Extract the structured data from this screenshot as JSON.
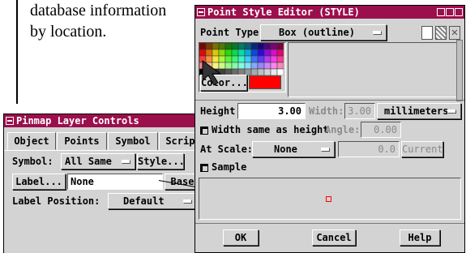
{
  "doc": {
    "text": "database information by location."
  },
  "pinmap": {
    "title": "Pinmap Layer Controls",
    "tabs": [
      "Object",
      "Points",
      "Symbol",
      "Script"
    ],
    "symbol_label": "Symbol:",
    "symbol_value": "All Same",
    "style_button": "Style...",
    "label_button": "Label...",
    "label_value": "None",
    "base_button": "Base",
    "label_position_label": "Label Position:",
    "label_position_value": "Default"
  },
  "style_editor": {
    "title": "Point Style Editor (STYLE)",
    "point_type_label": "Point Type:",
    "point_type_value": "Box (outline)",
    "color_button": "Color...",
    "selected_color": "#ff0000",
    "height_label": "Height:",
    "height_value": "3.00",
    "width_label": "Width:",
    "width_value": "3.00",
    "units_value": "millimeters",
    "width_same_label": "Width same as height",
    "angle_label": "Angle:",
    "angle_value": "0.00",
    "at_scale_label": "At Scale:",
    "at_scale_value": "None",
    "scale_value": "0.0",
    "current_button": "Current",
    "sample_label": "Sample",
    "ok_button": "OK",
    "cancel_button": "Cancel",
    "help_button": "Help"
  },
  "colors": {
    "titlebar": "#9b0f4c",
    "window_bg": "#d3d3d3",
    "accent": "#ff0000"
  }
}
